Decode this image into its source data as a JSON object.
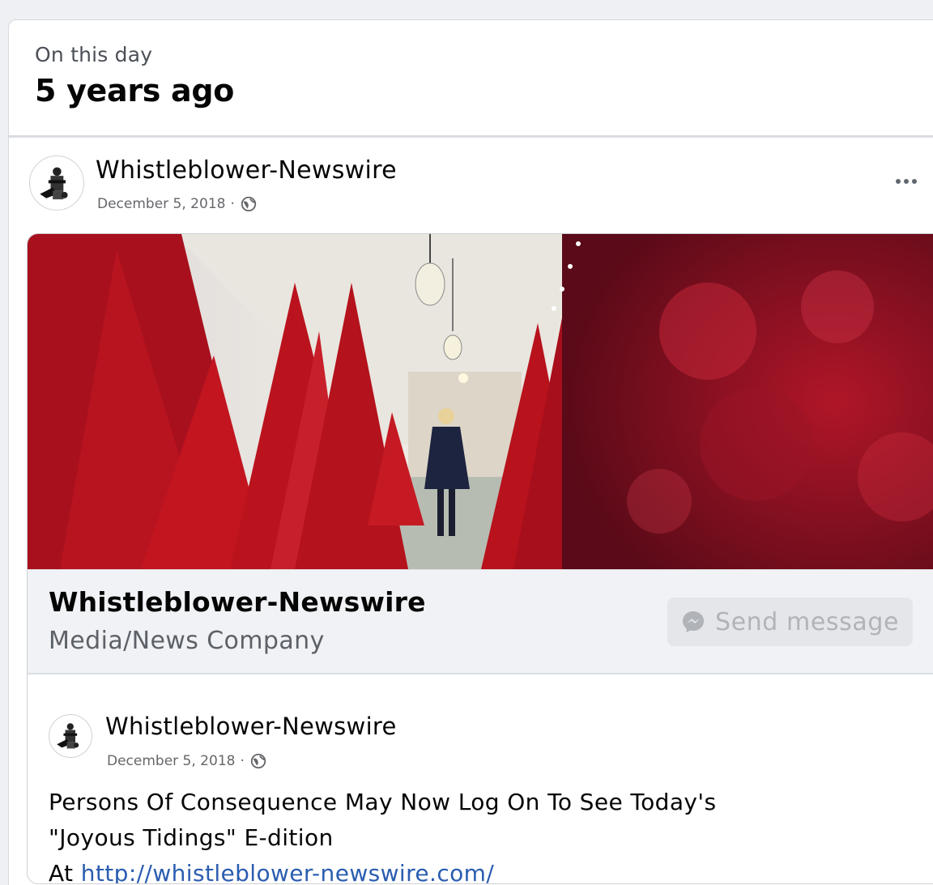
{
  "memory": {
    "label": "On this day",
    "title": "5 years ago"
  },
  "post": {
    "author": "Whistleblower-Newswire",
    "date": "December 5, 2018",
    "separator": "·"
  },
  "shared": {
    "page_name": "Whistleblower-Newswire",
    "page_category": "Media/News Company",
    "send_label": "Send message",
    "author": "Whistleblower-Newswire",
    "date": "December 5, 2018",
    "separator": "·",
    "text_line1": "Persons Of Consequence May Now Log On To See Today's",
    "text_line2": "\"Joyous Tidings\" E-dition",
    "text_prefix": "At ",
    "link": "http://whistleblower-newswire.com/"
  },
  "colors": {
    "link": "#2a5db0",
    "tree_red": "#c0121c",
    "card_bg": "#ffffff",
    "page_bg": "#eef0f4"
  },
  "icons": [
    "globe-icon",
    "more-icon",
    "messenger-icon",
    "avatar-logo"
  ]
}
